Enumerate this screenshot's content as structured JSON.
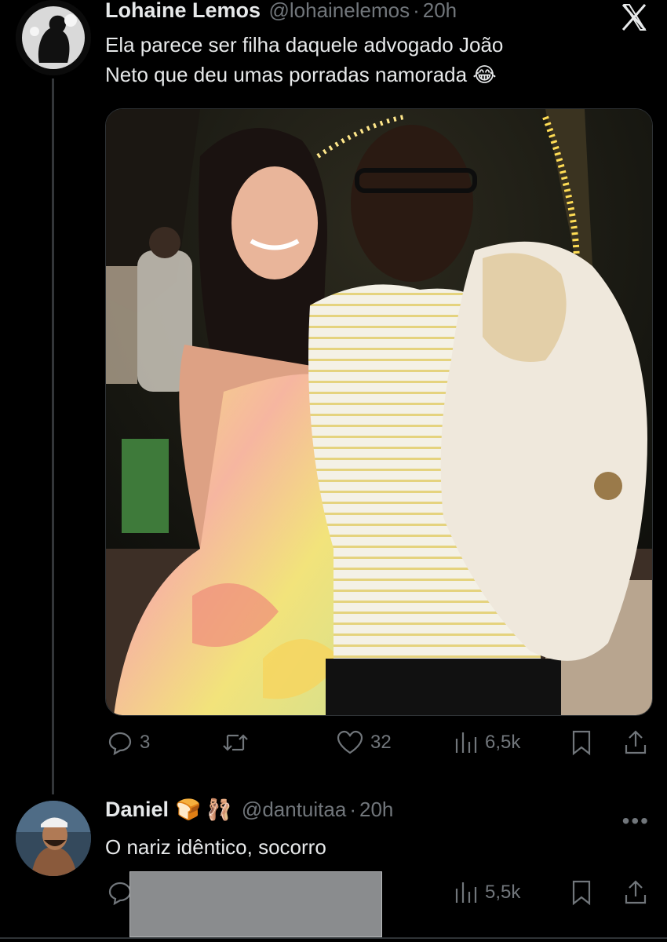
{
  "tweet1": {
    "name": "Lohaine Lemos",
    "handle": "@lohainelemos",
    "dot": "·",
    "time": "20h",
    "text_line1": "Ela parece ser filha daquele advogado João",
    "text_line2": "Neto que deu umas porradas namorada 😂",
    "actions": {
      "replies": "3",
      "retweets": "",
      "likes": "32",
      "views": "6,5k"
    }
  },
  "tweet2": {
    "name": "Daniel",
    "name_emojis": "🍞 🩰",
    "handle": "@dantuitaa",
    "dot": "·",
    "time": "20h",
    "text": "O nariz idêntico, socorro",
    "actions": {
      "views": "5,5k"
    }
  },
  "icons": {
    "close": "x-close-icon",
    "reply": "reply-icon",
    "retweet": "retweet-icon",
    "like": "heart-icon",
    "views": "views-icon",
    "bookmark": "bookmark-icon",
    "share": "share-icon",
    "more": "more-icon"
  },
  "more_label": "•••",
  "colors": {
    "background": "#000000",
    "text": "#e7e9ea",
    "muted": "#71767b"
  }
}
